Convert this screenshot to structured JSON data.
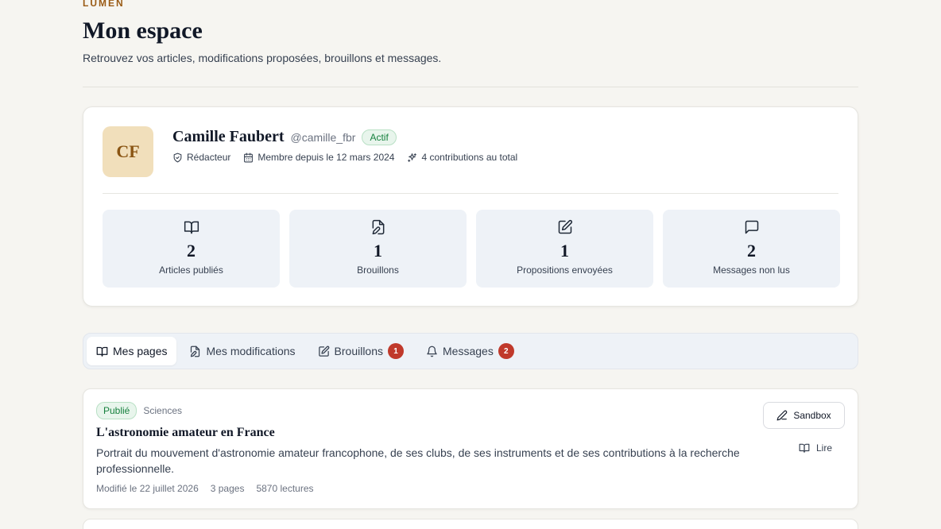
{
  "header": {
    "brand": "LUMEN",
    "title": "Mon espace",
    "subtitle": "Retrouvez vos articles, modifications proposées, brouillons et messages."
  },
  "profile": {
    "initials": "CF",
    "name": "Camille Faubert",
    "handle": "@camille_fbr",
    "status": "Actif",
    "role": "Rédacteur",
    "member_since": "Membre depuis le 12 mars 2024",
    "contributions": "4 contributions au total"
  },
  "stats": [
    {
      "icon": "book-open-icon",
      "value": "2",
      "label": "Articles publiés"
    },
    {
      "icon": "file-edit-icon",
      "value": "1",
      "label": "Brouillons"
    },
    {
      "icon": "pencil-square-icon",
      "value": "1",
      "label": "Propositions envoyées"
    },
    {
      "icon": "message-square-icon",
      "value": "2",
      "label": "Messages non lus"
    }
  ],
  "tabs": [
    {
      "label": "Mes pages",
      "icon": "book-open-icon",
      "active": true
    },
    {
      "label": "Mes modifications",
      "icon": "file-edit-icon"
    },
    {
      "label": "Brouillons",
      "icon": "pencil-square-icon",
      "badge": "1"
    },
    {
      "label": "Messages",
      "icon": "bell-icon",
      "badge": "2"
    }
  ],
  "articles": [
    {
      "status": "Publié",
      "category": "Sciences",
      "title": "L'astronomie amateur en France",
      "description": "Portrait du mouvement d'astronomie amateur francophone, de ses clubs, de ses instruments et de ses contributions à la recherche professionnelle.",
      "modified": "Modifié le 22 juillet 2026",
      "pages": "3 pages",
      "reads": "5870 lectures",
      "sandbox_label": "Sandbox",
      "read_label": "Lire"
    }
  ],
  "colors": {
    "background": "#f6f5f1",
    "accent_brand": "#9a5b16",
    "avatar_bg": "#f1dfbb",
    "success": "#15803d",
    "danger_badge": "#c0392b",
    "stat_bg": "#eef2f7"
  }
}
